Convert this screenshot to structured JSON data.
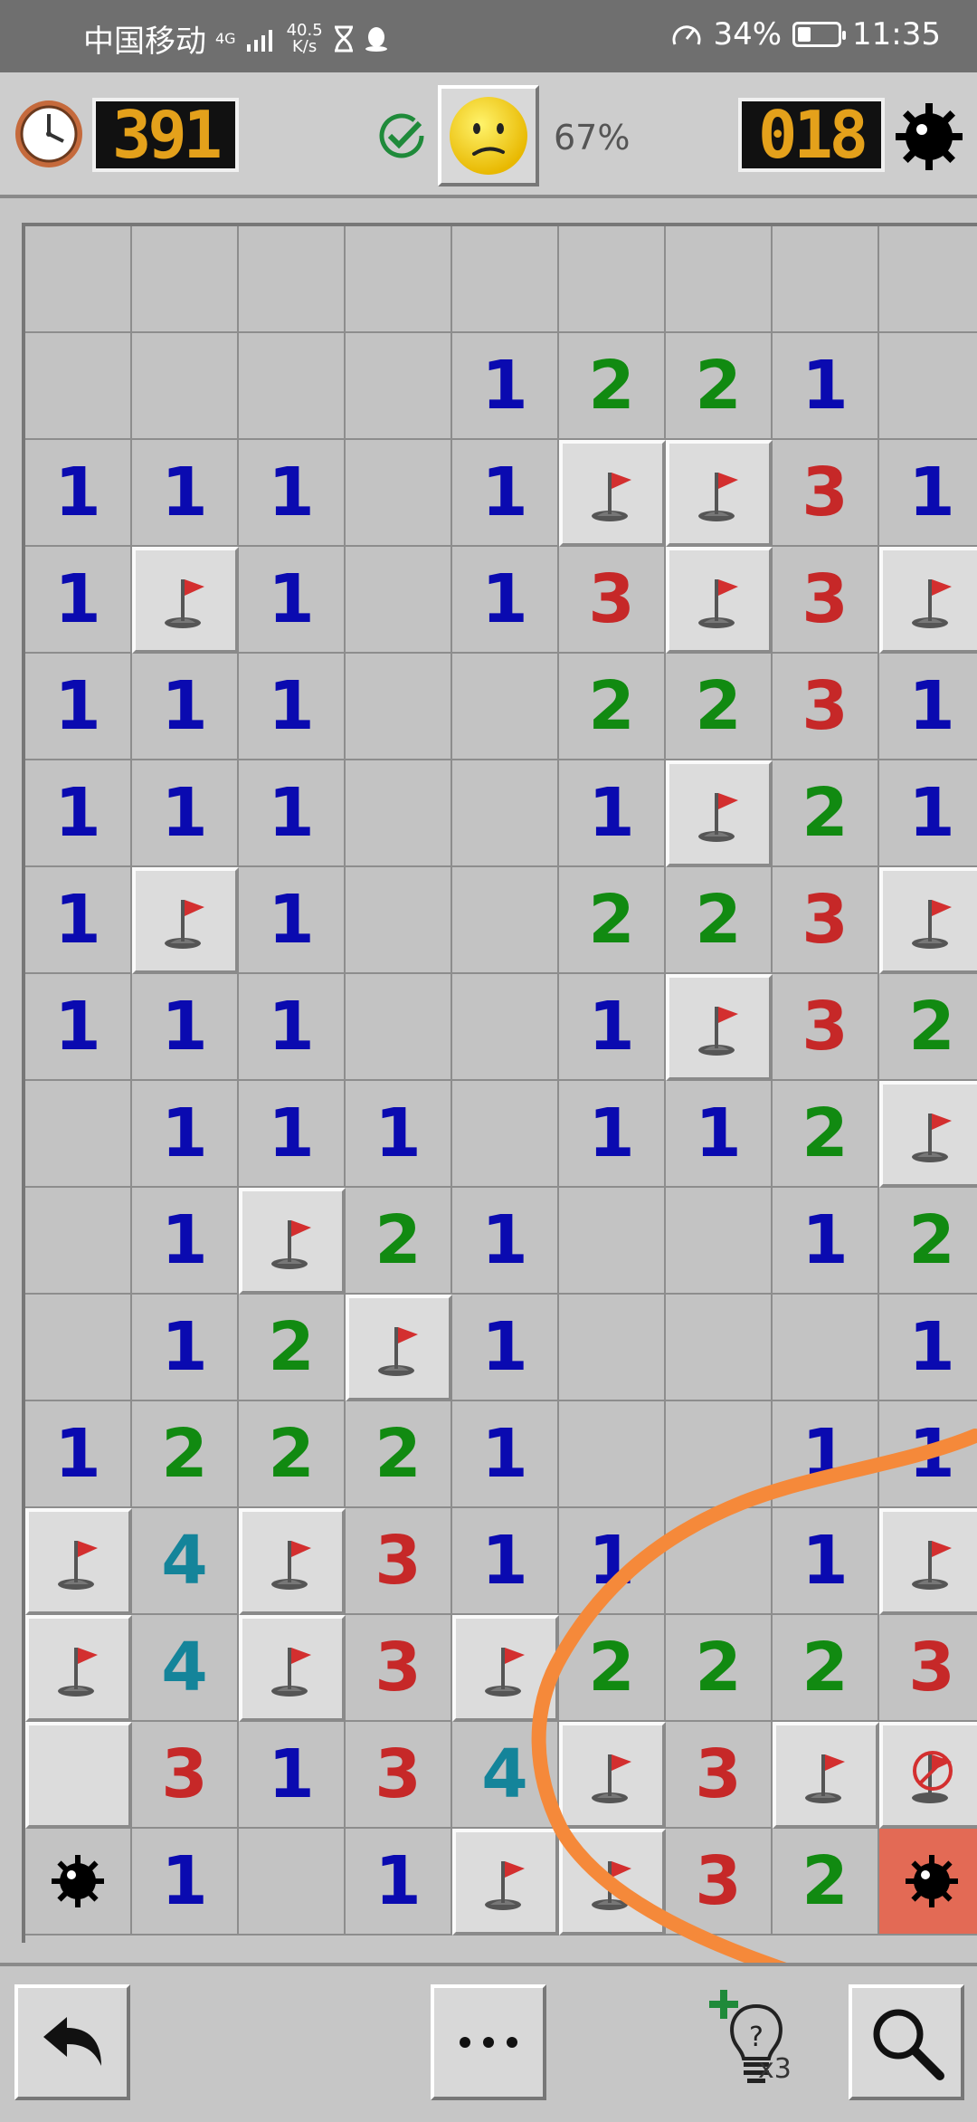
{
  "status_bar": {
    "carrier": "中国移动",
    "network_type": "4G",
    "speed_value": "40.5",
    "speed_unit": "K/s",
    "battery_percent": "34%",
    "battery_level": 0.34,
    "time": "11:35"
  },
  "header": {
    "timer": "391",
    "progress": "67%",
    "mines_left": "018",
    "face": "worried"
  },
  "board": {
    "columns": 9,
    "rows_visible": 16,
    "legend": "'' = empty revealed, digits = mine count, F = flag, X = wrong flag, M = mine, E = exploded mine, U = unrevealed",
    "rows": [
      [
        "",
        "",
        "",
        "",
        "",
        "",
        "",
        "",
        ""
      ],
      [
        "",
        "",
        "",
        "",
        "1",
        "2",
        "2",
        "1",
        ""
      ],
      [
        "1",
        "1",
        "1",
        "",
        "1",
        "F",
        "F",
        "3",
        "1"
      ],
      [
        "1",
        "F",
        "1",
        "",
        "1",
        "3",
        "F",
        "3",
        "F"
      ],
      [
        "1",
        "1",
        "1",
        "",
        "",
        "2",
        "2",
        "3",
        "1"
      ],
      [
        "1",
        "1",
        "1",
        "",
        "",
        "1",
        "F",
        "2",
        "1"
      ],
      [
        "1",
        "F",
        "1",
        "",
        "",
        "2",
        "2",
        "3",
        "F"
      ],
      [
        "1",
        "1",
        "1",
        "",
        "",
        "1",
        "F",
        "3",
        "2"
      ],
      [
        "",
        "1",
        "1",
        "1",
        "",
        "1",
        "1",
        "2",
        "F"
      ],
      [
        "",
        "1",
        "F",
        "2",
        "1",
        "",
        "",
        "1",
        "2"
      ],
      [
        "",
        "1",
        "2",
        "F",
        "1",
        "",
        "",
        "",
        "1"
      ],
      [
        "1",
        "2",
        "2",
        "2",
        "1",
        "",
        "",
        "1",
        "1"
      ],
      [
        "F",
        "4",
        "F",
        "3",
        "1",
        "1",
        "",
        "1",
        "F"
      ],
      [
        "F",
        "4",
        "F",
        "3",
        "F",
        "2",
        "2",
        "2",
        "3"
      ],
      [
        "U",
        "3",
        "1",
        "3",
        "4",
        "F",
        "3",
        "F",
        "X"
      ],
      [
        "M",
        "1",
        "",
        "1",
        "F",
        "F",
        "3",
        "2",
        "E"
      ]
    ]
  },
  "toolbar": {
    "hint_count": "x3"
  },
  "colors": {
    "n1": "#0a0ab0",
    "n2": "#118a11",
    "n3": "#c62828",
    "n4": "#14849a",
    "counter_digits": "#e4a11b",
    "exploded_cell": "#e36a55",
    "scribble": "#f5893a"
  },
  "icons": {
    "clock": "clock-icon",
    "check": "check-circle-icon",
    "face": "worried-face-icon",
    "mine": "mine-icon",
    "flag": "flag-icon",
    "undo": "undo-arrow-icon",
    "more": "ellipsis-icon",
    "hint": "lightbulb-question-icon",
    "zoom": "magnifier-icon"
  }
}
